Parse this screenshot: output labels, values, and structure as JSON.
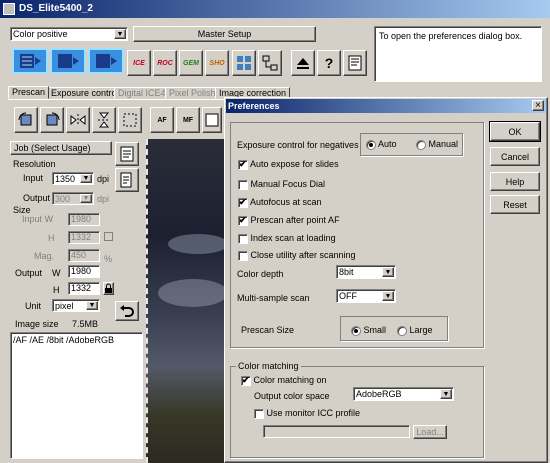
{
  "window_title": "DS_Elite5400_2",
  "mode_select": "Color positive",
  "master_setup": "Master Setup",
  "info_text": "To open the preferences dialog box.",
  "icon_buttons": [
    "ICE",
    "ROC",
    "GEM",
    "SHO"
  ],
  "help_glyph": "?",
  "tabs": [
    "Prescan",
    "Exposure control",
    "Digital ICE4",
    "Pixel Polish",
    "Image correction"
  ],
  "job_label": "Job (Select Usage)",
  "resolution": {
    "heading": "Resolution",
    "input_label": "Input",
    "input_value": "1350",
    "input_unit": "dpi",
    "output_label": "Output",
    "output_value": "300",
    "output_unit": "dpi"
  },
  "size": {
    "heading": "Size",
    "input_w_label": "Input  W",
    "input_w": "1980",
    "h_label": "H",
    "input_h": "1332",
    "mag_label": "Mag.",
    "mag": "450",
    "mag_unit": "%",
    "output_label": "Output",
    "w_label": "W",
    "output_w": "1980",
    "output_h": "1332",
    "unit_label": "Unit",
    "unit_value": "pixel"
  },
  "image_size_label": "Image size",
  "image_size_value": "7.5MB",
  "status_line": "/AF /AE /8bit /AdobeRGB",
  "af_label": "AF",
  "mf_label": "MF",
  "dialog": {
    "title": "Preferences",
    "close_glyph": "×",
    "exposure_label": "Exposure control for negatives",
    "exposure_auto": "Auto",
    "exposure_manual": "Manual",
    "checks": [
      {
        "label": "Auto expose for slides",
        "checked": true
      },
      {
        "label": "Manual Focus Dial",
        "checked": false
      },
      {
        "label": "Autofocus at scan",
        "checked": true
      },
      {
        "label": "Prescan after point AF",
        "checked": true
      },
      {
        "label": "Index scan at loading",
        "checked": false
      },
      {
        "label": "Close utility after scanning",
        "checked": false
      }
    ],
    "color_depth_label": "Color depth",
    "color_depth_value": "8bit",
    "multisample_label": "Multi-sample scan",
    "multisample_value": "OFF",
    "prescan_size_label": "Prescan Size",
    "prescan_small": "Small",
    "prescan_large": "Large",
    "color_matching_group": "Color matching",
    "color_matching_on": "Color matching on",
    "output_color_space_label": "Output color space",
    "output_color_space_value": "AdobeRGB",
    "monitor_icc": "Use monitor ICC profile",
    "load_button": "Load...",
    "buttons": {
      "ok": "OK",
      "cancel": "Cancel",
      "help": "Help",
      "reset": "Reset"
    }
  }
}
